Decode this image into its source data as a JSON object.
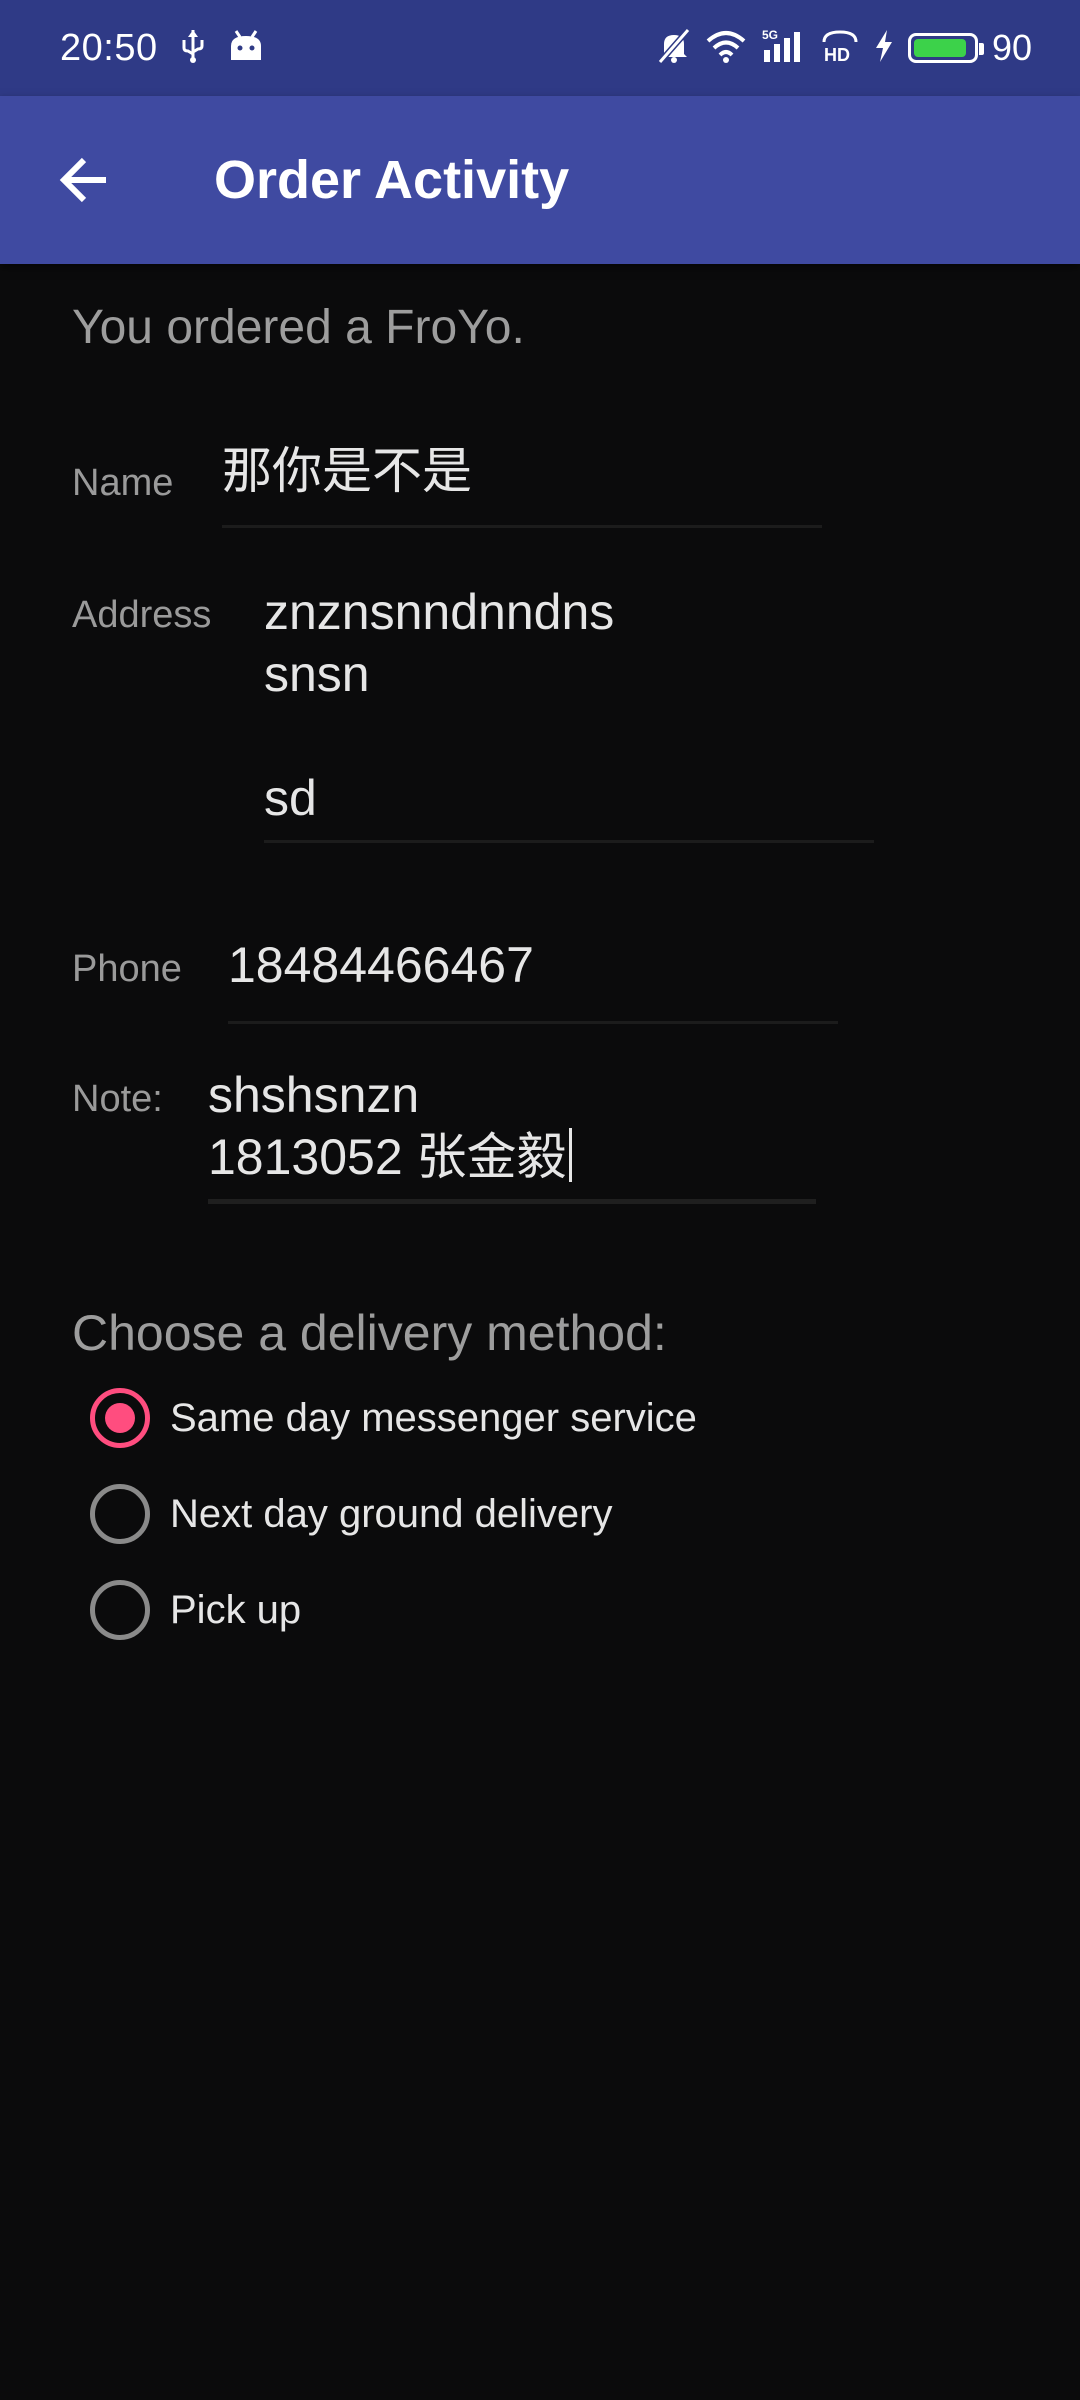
{
  "status_bar": {
    "time": "20:50",
    "battery_level": "90",
    "battery_fraction": 0.9,
    "battery_color": "#3cd24a",
    "icons": [
      "usb-icon",
      "android-icon",
      "mute-icon",
      "wifi-icon",
      "5g-signal-icon",
      "hd-icon",
      "charging-icon",
      "battery-icon"
    ]
  },
  "app_bar": {
    "title": "Order Activity",
    "back_icon": "arrow-back-icon",
    "color": "#3f4aa1"
  },
  "order": {
    "ordered_text": "You ordered a FroYo.",
    "fields": {
      "name": {
        "label": "Name",
        "value": "那你是不是"
      },
      "address": {
        "label": "Address",
        "value": "znznsnndnndns\nsnsn\n\nsd"
      },
      "phone": {
        "label": "Phone",
        "value": "18484466467"
      },
      "note": {
        "label": "Note:",
        "value": "shshsnzn\n1813052 张金毅"
      }
    }
  },
  "delivery": {
    "heading": "Choose a delivery method:",
    "accent_color": "#ff4d7f",
    "options": [
      {
        "label": "Same day messenger service",
        "checked": true
      },
      {
        "label": "Next day ground delivery",
        "checked": false
      },
      {
        "label": "Pick up",
        "checked": false
      }
    ]
  }
}
